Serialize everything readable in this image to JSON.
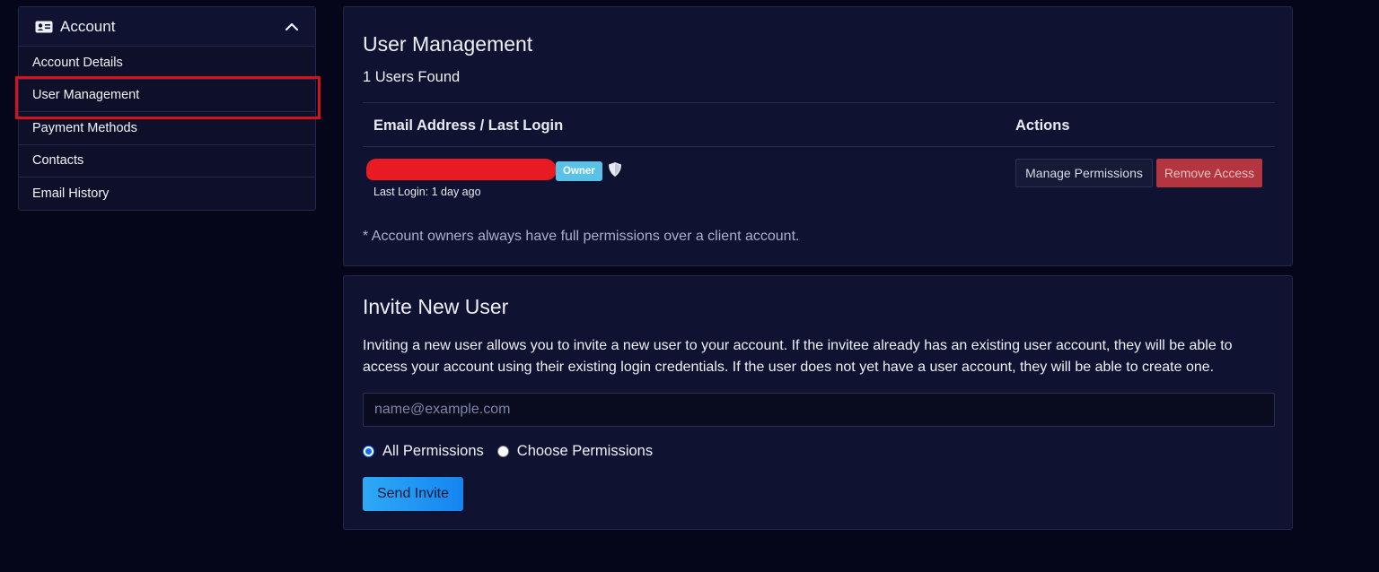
{
  "sidebar": {
    "header_title": "Account",
    "header_icon": "id-card-icon",
    "collapse_icon": "chevron-up-icon",
    "items": [
      {
        "label": "Account Details"
      },
      {
        "label": "User Management"
      },
      {
        "label": "Payment Methods"
      },
      {
        "label": "Contacts"
      },
      {
        "label": "Email History"
      }
    ],
    "active_index": 1
  },
  "user_management": {
    "title": "User Management",
    "users_found": "1 Users Found",
    "columns": {
      "email": "Email Address / Last Login",
      "actions": "Actions"
    },
    "rows": [
      {
        "email": "",
        "badge": "Owner",
        "shield_icon": "shield-icon",
        "last_login": "Last Login: 1 day ago",
        "manage_label": "Manage Permissions",
        "remove_label": "Remove Access"
      }
    ],
    "note": "* Account owners always have full permissions over a client account."
  },
  "invite": {
    "title": "Invite New User",
    "description": "Inviting a new user allows you to invite a new user to your account. If the invitee already has an existing user account, they will be able to access your account using their existing login credentials. If the user does not yet have a user account, they will be able to create one.",
    "email_placeholder": "name@example.com",
    "email_value": "",
    "options": [
      {
        "label": "All Permissions",
        "checked": true
      },
      {
        "label": "Choose Permissions",
        "checked": false
      }
    ],
    "send_label": "Send Invite"
  },
  "colors": {
    "background": "#050619",
    "card": "#0f1230",
    "highlight_box": "#d4121b",
    "owner_badge": "#5ac2e6",
    "remove_button": "#b3353f",
    "send_button": "#1485f0"
  }
}
